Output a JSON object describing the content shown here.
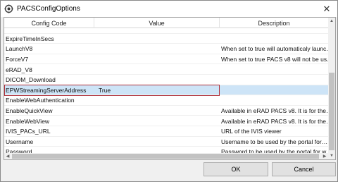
{
  "window": {
    "title": "PACSConfigOptions",
    "close_glyph": "✕"
  },
  "columns": {
    "code": "Config Code",
    "value": "Value",
    "description": "Description"
  },
  "rows": [
    {
      "code": "",
      "value": "",
      "description": ""
    },
    {
      "code": "ExpireTimeInSecs",
      "value": "",
      "description": ""
    },
    {
      "code": "LaunchV8",
      "value": "",
      "description": "When set to true will automaticaly launc…"
    },
    {
      "code": "ForceV7",
      "value": "",
      "description": "When set to true PACS v8 will not be us…"
    },
    {
      "code": "eRAD_V8",
      "value": "",
      "description": ""
    },
    {
      "code": "DICOM_Download",
      "value": "",
      "description": ""
    },
    {
      "code": "EPWStreamingServerAddress",
      "value": "True",
      "description": ""
    },
    {
      "code": "EnableWebAuthentication",
      "value": "",
      "description": ""
    },
    {
      "code": "EnableQuickView",
      "value": "",
      "description": "Available in eRAD PACS v8. It is for the…"
    },
    {
      "code": "EnableWebView",
      "value": "",
      "description": "Available in eRAD PACS v8. It is for the…"
    },
    {
      "code": "IVIS_PACs_URL",
      "value": "",
      "description": "URL of the IVIS viewer"
    },
    {
      "code": "Username",
      "value": "",
      "description": "Username to be used by the portal for…"
    },
    {
      "code": "Password",
      "value": "",
      "description": "Password to be used by the portal for w…"
    }
  ],
  "selected_row": 6,
  "buttons": {
    "ok": "OK",
    "cancel": "Cancel"
  },
  "scroll_arrows": {
    "up": "▲",
    "down": "▼",
    "left": "◀",
    "right": "▶"
  },
  "icons": {
    "app": "gear-icon",
    "close": "close-icon"
  },
  "colors": {
    "selection": "#cde4f7",
    "selection_border": "#b0303a"
  }
}
